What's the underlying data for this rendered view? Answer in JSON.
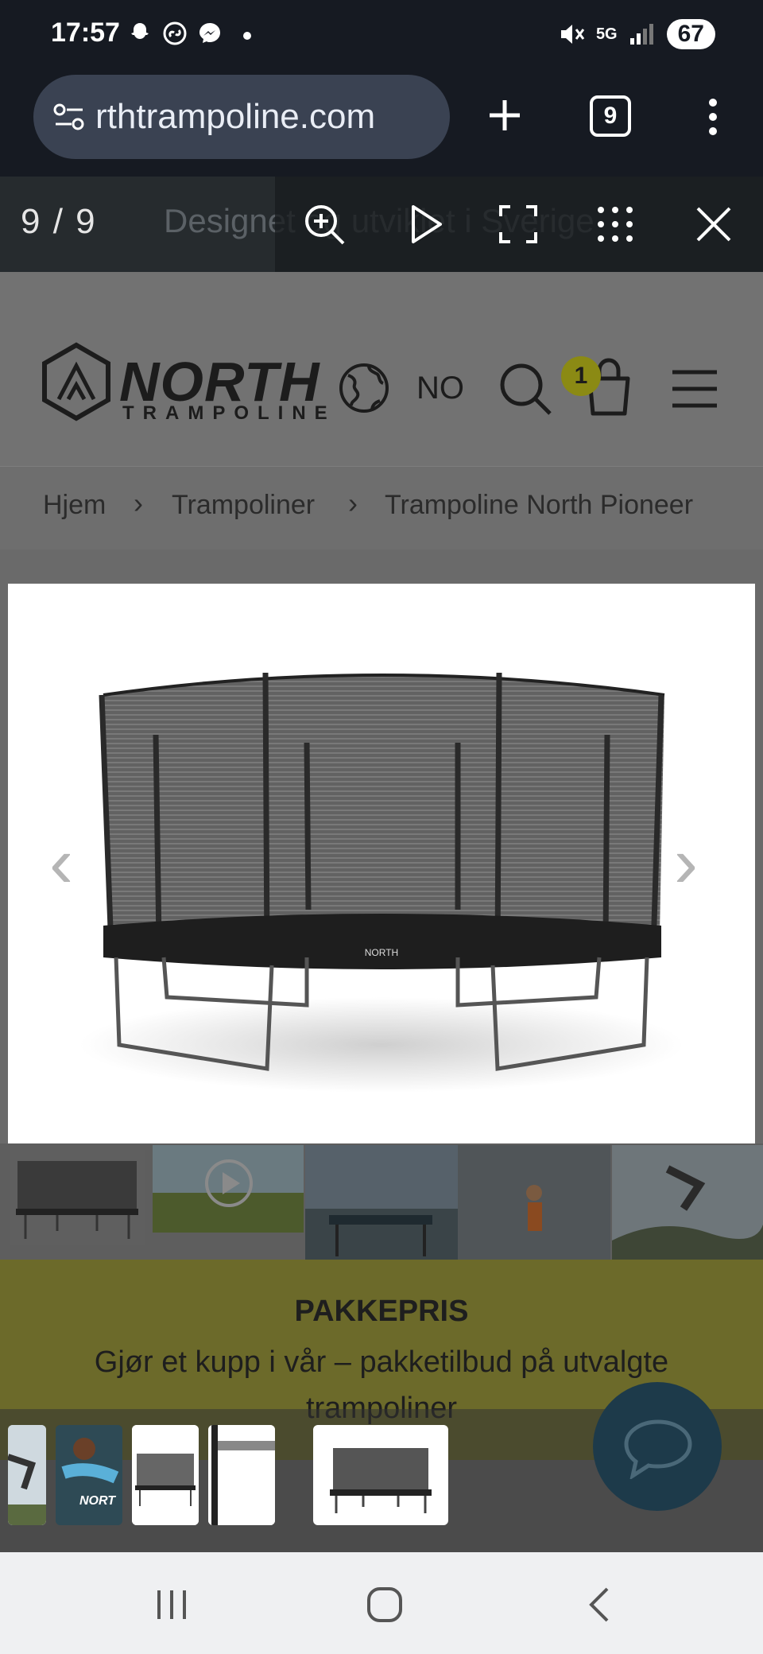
{
  "status": {
    "time": "17:57",
    "battery": "67",
    "network": "5G"
  },
  "browser": {
    "url": "rthtrampoline.com",
    "tab_count": "9"
  },
  "gallery": {
    "counter": "9 / 9",
    "banner_text": "Designet og utviklet i Sverige"
  },
  "site": {
    "logo": "NORTH",
    "logo_sub": "TRAMPOLINE",
    "language": "NO",
    "cart_count": "1"
  },
  "breadcrumbs": [
    "Hjem",
    "Trampoliner",
    "Trampoline North Pioneer"
  ],
  "promo": {
    "title": "PAKKEPRIS",
    "text": "Gjør et kupp i vår – pakketilbud på utvalgte trampoliner"
  },
  "filmstrip": {
    "brand_text": "NORT"
  },
  "colors": {
    "accent": "#8b8a14",
    "dark": "#161a22",
    "chat": "#1d3a4a"
  }
}
